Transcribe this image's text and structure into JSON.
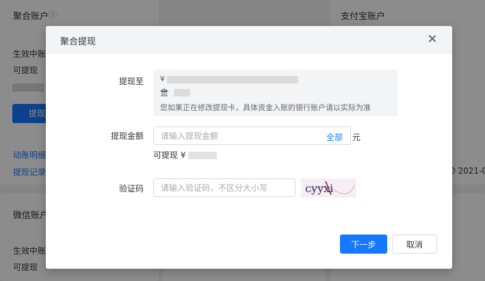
{
  "background": {
    "card1_title": "聚合账户",
    "card1_status": "生效中账户",
    "card1_available": "可提现",
    "card1_button": "提现",
    "card1_link1": "动账明细",
    "card1_link2": "提现记录",
    "card2_title": "支付宝账户",
    "card2_date": "0  2021-0",
    "card3_title": "微信账户",
    "card3_status": "生效中账户",
    "card3_available": "可提现"
  },
  "dialog": {
    "title": "聚合提现",
    "withdraw_to_label": "提现至",
    "currency_symbol": "¥",
    "bank_icon": "bank-icon",
    "bank_note": "您如果正在修改提现卡，具体资金入账的银行账户请以实际为准",
    "amount_label": "提现金额",
    "amount_placeholder": "请输入提现金额",
    "all_button": "全部",
    "unit": "元",
    "available_label": "可提现 ¥",
    "captcha_label": "验证码",
    "captcha_placeholder": "请输入验证码，不区分大小写",
    "captcha_text": "cyyxi",
    "next_button": "下一步",
    "cancel_button": "取消"
  },
  "colors": {
    "primary": "#1677ff",
    "header_bg": "#f3f4f6",
    "overlay": "rgba(0,0,0,0.45)"
  }
}
